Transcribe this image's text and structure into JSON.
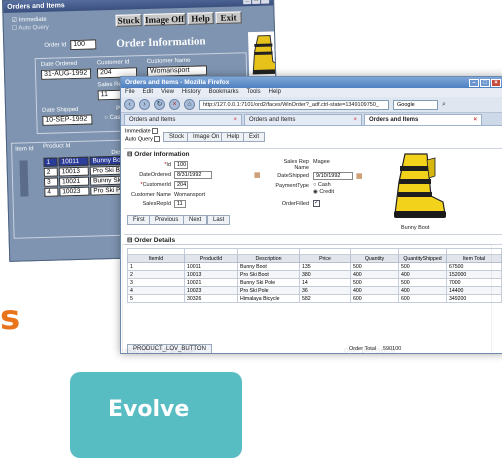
{
  "legacy": {
    "title": "Orders and Items",
    "win_controls": [
      "_",
      "□",
      "×"
    ],
    "immediate_label": "Immediate",
    "auto_query_label": "Auto Query",
    "buttons": [
      "Stuck",
      "Image Off",
      "Help",
      "Exit"
    ],
    "order_id_label": "Order Id",
    "order_id": "100",
    "heading": "Order Information",
    "date_ordered_label": "Date Ordered",
    "date_ordered": "31-AUG-1992",
    "customer_id_label": "Customer Id",
    "customer_id": "204",
    "customer_name_label": "Customer Name",
    "customer_name": "Womansport",
    "sales_rep_label": "Sales Rep Id",
    "sales_rep_id": "11",
    "date_shipped_label": "Date Shipped",
    "date_shipped": "10-SEP-1992",
    "payment_fragment": "Pay",
    "cash_label": "Cash",
    "items_header": [
      "Item Id",
      "Product Id",
      "Desc"
    ],
    "items": [
      {
        "item": "1",
        "product": "10011",
        "desc": "Bunny Boot"
      },
      {
        "item": "2",
        "product": "10013",
        "desc": "Pro Ski Boot"
      },
      {
        "item": "3",
        "product": "10021",
        "desc": "Bunny Ski Pole"
      },
      {
        "item": "4",
        "product": "10023",
        "desc": "Pro Ski Pole"
      }
    ]
  },
  "browser": {
    "title": "Orders and Items - Mozilla Firefox",
    "menu": [
      "File",
      "Edit",
      "View",
      "History",
      "Bookmarks",
      "Tools",
      "Help"
    ],
    "url": "http://127.0.0.1:7101/ord2/faces/WinOrder?_adf.ctrl-state=1349109750_",
    "search_placeholder": "Google",
    "tabs": [
      "Orders and Items",
      "Orders and Items",
      "Orders and Items"
    ]
  },
  "app": {
    "immediate_label": "Immediate",
    "auto_query_label": "Auto Query",
    "toolbar": [
      "Stock",
      "Image On",
      "Help",
      "Exit"
    ],
    "order_section": "Order Information",
    "id_label": "Id",
    "id_value": "100",
    "date_ordered_label": "DateOrdered",
    "date_ordered": "8/31/1992",
    "customer_id_label": "CustomerId",
    "customer_id": "204",
    "customer_name_label": "Customer Name",
    "customer_name": "Womansport",
    "sales_rep_id_label": "SalesRepId",
    "sales_rep_id": "11",
    "sales_rep_name_label": "Sales Rep Name",
    "sales_rep_name": "Magee",
    "date_shipped_label": "DateShipped",
    "date_shipped": "9/10/1992",
    "payment_type_label": "PaymentType",
    "payment_options": [
      "Cash",
      "Credit"
    ],
    "payment_selected": "Credit",
    "order_filled_label": "OrderFilled",
    "nav": [
      "First",
      "Previous",
      "Next",
      "Last"
    ],
    "product_caption": "Bunny Boot",
    "details_section": "Order Details",
    "columns": [
      "ItemId",
      "ProductId",
      "Description",
      "Price",
      "Quantity",
      "QuantityShipped",
      "Item Total"
    ],
    "rows": [
      [
        "1",
        "10011",
        "Bunny Boot",
        "135",
        "500",
        "500",
        "67500"
      ],
      [
        "2",
        "10013",
        "Pro Ski Boot",
        "380",
        "400",
        "400",
        "152000"
      ],
      [
        "3",
        "10021",
        "Bunny Ski Pole",
        "14",
        "500",
        "500",
        "7000"
      ],
      [
        "4",
        "10023",
        "Pro Ski Pole",
        "36",
        "400",
        "400",
        "14400"
      ],
      [
        "5",
        "30326",
        "Himalaya Bicycle",
        "582",
        "600",
        "600",
        "349200"
      ]
    ],
    "lov_button": "PRODUCT_LOV_BUTTON",
    "order_total_label": "Order Total",
    "order_total": "590100"
  },
  "decor": {
    "evolve_label": "Evolve",
    "left_letter": "s",
    "reflect_lov": "PRODUCT_LOV_BUTTON",
    "reflect_total": "Order Total  590100"
  },
  "colors": {
    "accent_orange": "#e8741c",
    "evolve_teal": "#4fb8c0",
    "legacy_bg": "#7e94b0"
  }
}
